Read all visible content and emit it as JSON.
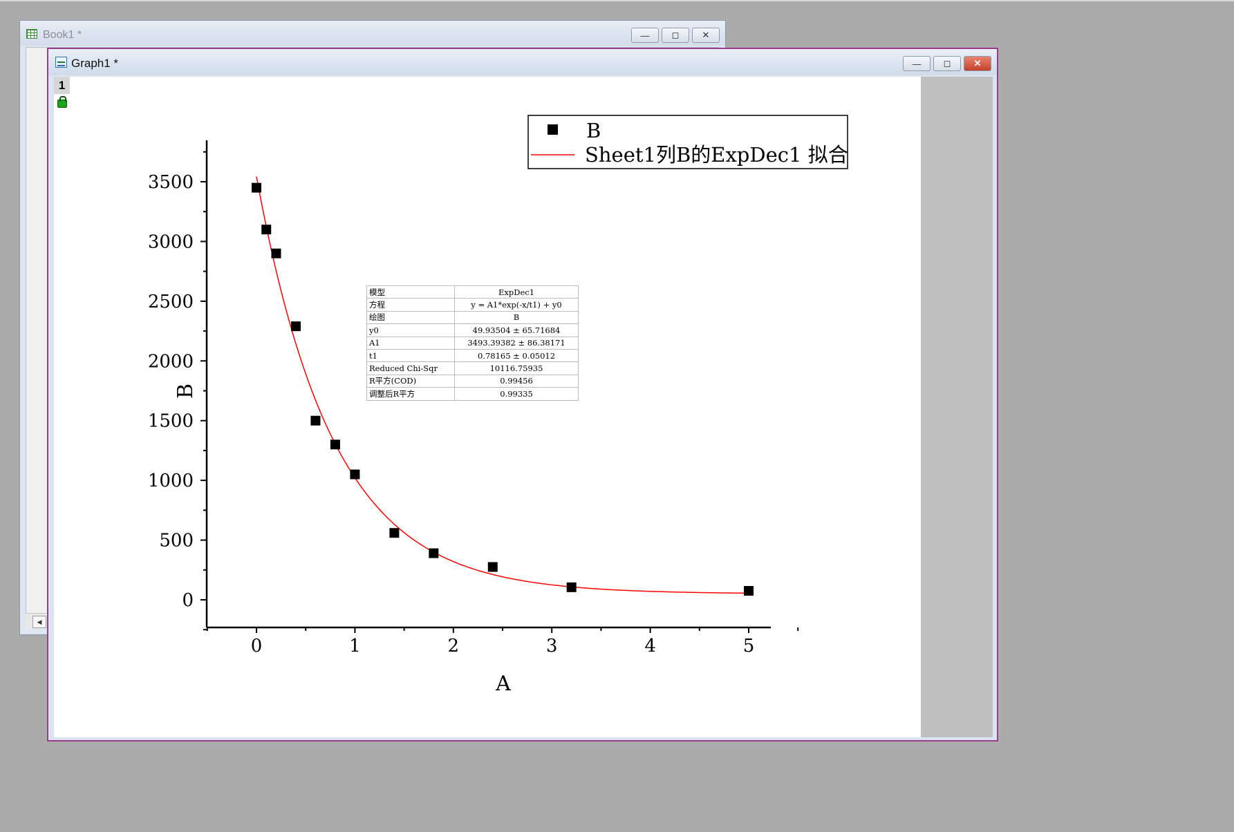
{
  "book_window": {
    "title": "Book1 *"
  },
  "graph_window": {
    "title": "Graph1 *",
    "layer_label": "1"
  },
  "window_buttons": {
    "minimize": "—",
    "restore": "◻",
    "close": "✕"
  },
  "legend": {
    "scatter_label": "B",
    "fit_label": "Sheet1列B的ExpDec1 拟合"
  },
  "stats_table": [
    {
      "key": "模型",
      "value": "ExpDec1"
    },
    {
      "key": "方程",
      "value": "y = A1*exp(-x/t1) + y0"
    },
    {
      "key": "绘图",
      "value": "B"
    },
    {
      "key": "y0",
      "value": "49.93504 ± 65.71684"
    },
    {
      "key": "A1",
      "value": "3493.39382 ± 86.38171"
    },
    {
      "key": "t1",
      "value": "0.78165 ± 0.05012"
    },
    {
      "key": "Reduced Chi-Sqr",
      "value": "10116.75935"
    },
    {
      "key": "R平方(COD)",
      "value": "0.99456"
    },
    {
      "key": "调整后R平方",
      "value": "0.99335"
    }
  ],
  "chart_data": {
    "type": "scatter",
    "xlabel": "A",
    "ylabel": "B",
    "xlim": [
      -0.5,
      5.5
    ],
    "ylim": [
      -250,
      3750
    ],
    "x_ticks": [
      0,
      1,
      2,
      3,
      4,
      5
    ],
    "x_tick_labels": [
      "0",
      "1",
      "2",
      "3",
      "4",
      "5"
    ],
    "y_ticks": [
      0,
      500,
      1000,
      1500,
      2000,
      2500,
      3000,
      3500
    ],
    "y_tick_labels": [
      "0",
      "500",
      "1000",
      "1500",
      "2000",
      "2500",
      "3000",
      "3500"
    ],
    "legend_position": "top-right",
    "series": [
      {
        "name": "B",
        "kind": "scatter",
        "marker": "square",
        "color": "#000000",
        "x": [
          0,
          0.1,
          0.2,
          0.4,
          0.6,
          0.8,
          1.0,
          1.4,
          1.8,
          2.4,
          3.2,
          5.0
        ],
        "y": [
          3450,
          3100,
          2900,
          2290,
          1500,
          1300,
          1050,
          560,
          390,
          275,
          105,
          75
        ]
      },
      {
        "name": "Sheet1列B的ExpDec1 拟合",
        "kind": "line",
        "color": "#ff0000",
        "fit": {
          "model": "ExpDec1",
          "y0": 49.93504,
          "A1": 3493.39382,
          "t1": 0.78165,
          "x_range": [
            0,
            5
          ]
        }
      }
    ]
  }
}
